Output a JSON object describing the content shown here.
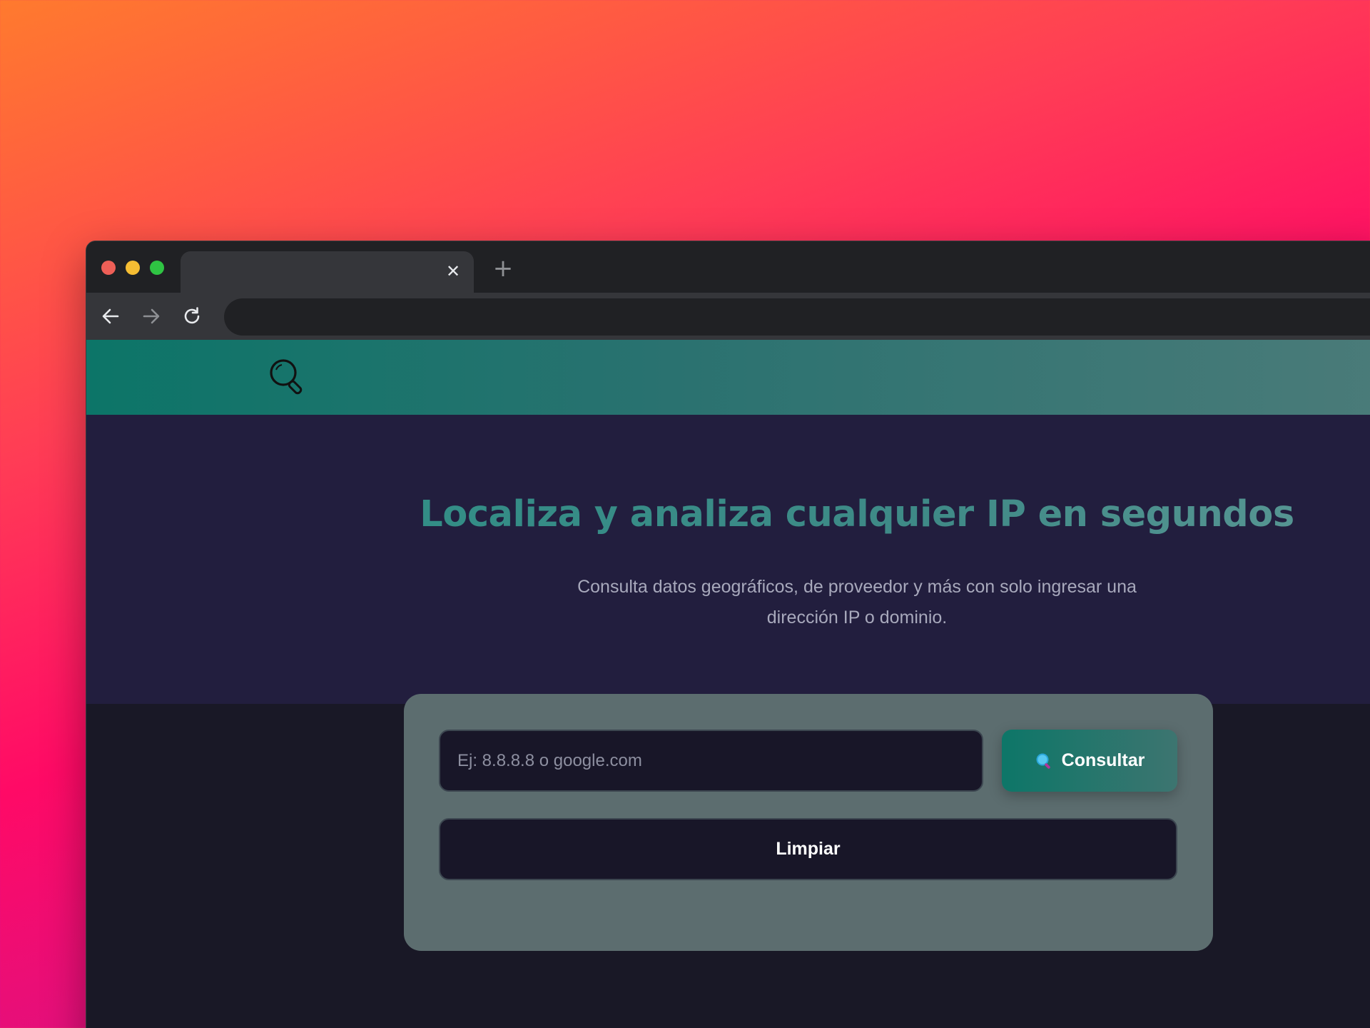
{
  "browser": {
    "tab_close_glyph": "✕",
    "new_tab_glyph": "+",
    "address_value": ""
  },
  "header": {
    "logo_icon": "magnifier-icon"
  },
  "hero": {
    "title": "Localiza y analiza cualquier IP en segundos",
    "subtitle": "Consulta datos geográficos, de proveedor y más con solo ingresar una dirección IP o dominio."
  },
  "search": {
    "input_value": "",
    "placeholder": "Ej: 8.8.8.8 o google.com",
    "consult_label": "Consultar",
    "consult_icon": "search-icon",
    "clear_label": "Limpiar"
  },
  "colors": {
    "header_gradient": [
      "#0c7568",
      "#4a7b79"
    ],
    "hero_bg": "#221e3e",
    "page_bg": "#191826",
    "card_bg": "#5c6d6f",
    "accent": "#0d7668"
  }
}
